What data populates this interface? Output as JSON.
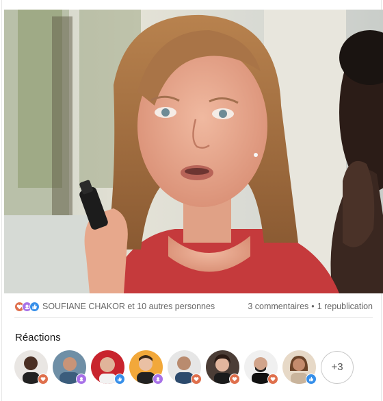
{
  "post": {
    "image_alt": "Photo of a woman with long blonde hair speaking, holding a small bottle"
  },
  "social": {
    "reaction_icons": [
      "love-icon",
      "support-icon",
      "like-icon"
    ],
    "names": "SOUFIANE CHAKOR et 10 autres personnes",
    "comments": "3 commentaires",
    "separator": "•",
    "reposts": "1 republication"
  },
  "reactions": {
    "title": "Réactions",
    "more_label": "+3",
    "people": [
      {
        "badge": "love-icon"
      },
      {
        "badge": "support-icon"
      },
      {
        "badge": "like-icon"
      },
      {
        "badge": "support-icon"
      },
      {
        "badge": "love-icon"
      },
      {
        "badge": "love-icon"
      },
      {
        "badge": "love-icon"
      },
      {
        "badge": "like-icon"
      }
    ]
  },
  "colors": {
    "like": "#378fe9",
    "love": "#df704d",
    "support": "#a872e8",
    "text_muted": "#666666"
  }
}
